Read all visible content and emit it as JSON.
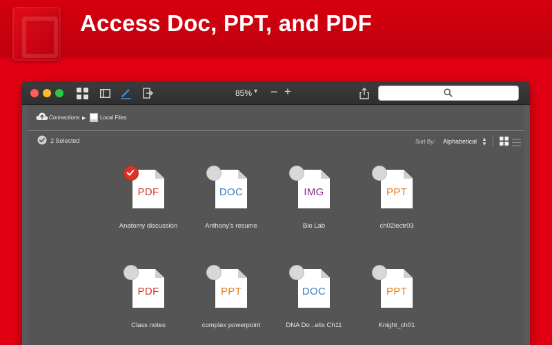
{
  "banner": {
    "headline": "Access Doc, PPT, and PDF"
  },
  "toolbar": {
    "zoom": "85%"
  },
  "breadcrumb": {
    "connections": "Connections",
    "separator": "▶",
    "local_files": "Local Files"
  },
  "selection": {
    "text": "2 Selected"
  },
  "sort": {
    "label": "Sort By:",
    "value": "Alphabetical"
  },
  "colors": {
    "pdf": "#d9342a",
    "doc": "#3a7dc0",
    "img": "#8b2a8c",
    "ppt": "#e57e22"
  },
  "files": [
    {
      "name": "Anatomy discussion",
      "type": "PDF",
      "selected": true
    },
    {
      "name": "Anthony's resume",
      "type": "DOC",
      "selected": false
    },
    {
      "name": "Bio Lab",
      "type": "IMG",
      "selected": false
    },
    {
      "name": "ch02lectr03",
      "type": "PPT",
      "selected": false
    },
    {
      "name": "Class notes",
      "type": "PDF",
      "selected": false
    },
    {
      "name": "complex powerpoint",
      "type": "PPT",
      "selected": false
    },
    {
      "name": "DNA Do...elix Ch11",
      "type": "DOC",
      "selected": false
    },
    {
      "name": "Knight_ch01",
      "type": "PPT",
      "selected": false
    }
  ]
}
